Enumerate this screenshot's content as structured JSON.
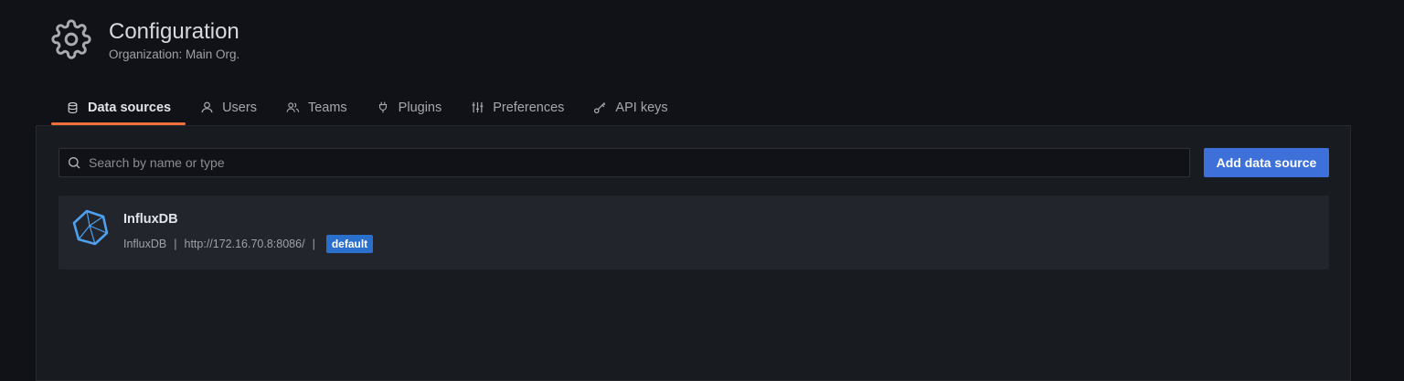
{
  "header": {
    "title": "Configuration",
    "subtitle": "Organization: Main Org.",
    "icon": "gear-icon"
  },
  "tabs": [
    {
      "label": "Data sources",
      "icon": "database-icon",
      "active": true
    },
    {
      "label": "Users",
      "icon": "user-icon",
      "active": false
    },
    {
      "label": "Teams",
      "icon": "users-icon",
      "active": false
    },
    {
      "label": "Plugins",
      "icon": "plug-icon",
      "active": false
    },
    {
      "label": "Preferences",
      "icon": "sliders-icon",
      "active": false
    },
    {
      "label": "API keys",
      "icon": "key-icon",
      "active": false
    }
  ],
  "search": {
    "placeholder": "Search by name or type",
    "value": ""
  },
  "add_button_label": "Add data source",
  "datasources": [
    {
      "name": "InfluxDB",
      "type": "InfluxDB",
      "separator": "|",
      "url": "http://172.16.70.8:8086/",
      "badge": "default",
      "icon": "influxdb-logo"
    }
  ],
  "colors": {
    "accent": "#3d71d9",
    "tab_active_underline": "#f0703c",
    "badge": "#2a6fcb",
    "influx_logo": "#4ea0f0"
  }
}
